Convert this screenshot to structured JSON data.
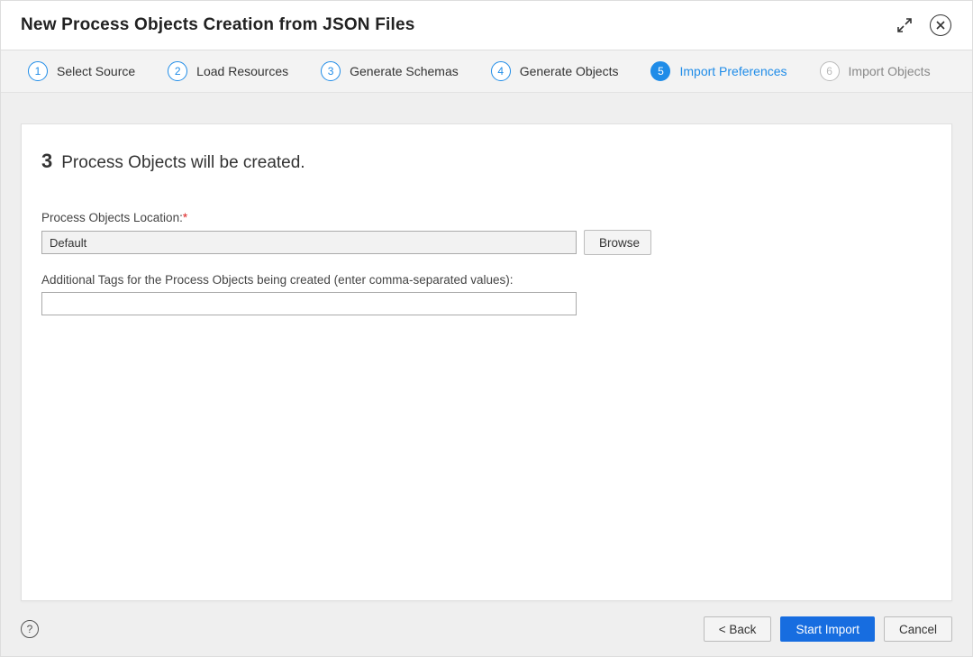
{
  "title": "New Process Objects Creation from JSON Files",
  "steps": [
    {
      "num": "1",
      "label": "Select Source"
    },
    {
      "num": "2",
      "label": "Load Resources"
    },
    {
      "num": "3",
      "label": "Generate Schemas"
    },
    {
      "num": "4",
      "label": "Generate Objects"
    },
    {
      "num": "5",
      "label": "Import Preferences"
    },
    {
      "num": "6",
      "label": "Import Objects"
    }
  ],
  "summary": {
    "count": "3",
    "text": "Process Objects will be created."
  },
  "fields": {
    "location_label": "Process Objects Location:",
    "location_value": "Default",
    "browse_label": "Browse",
    "tags_label": "Additional Tags for the Process Objects being created (enter comma-separated values):",
    "tags_value": ""
  },
  "footer": {
    "back": "< Back",
    "start": "Start Import",
    "cancel": "Cancel",
    "help": "?"
  }
}
